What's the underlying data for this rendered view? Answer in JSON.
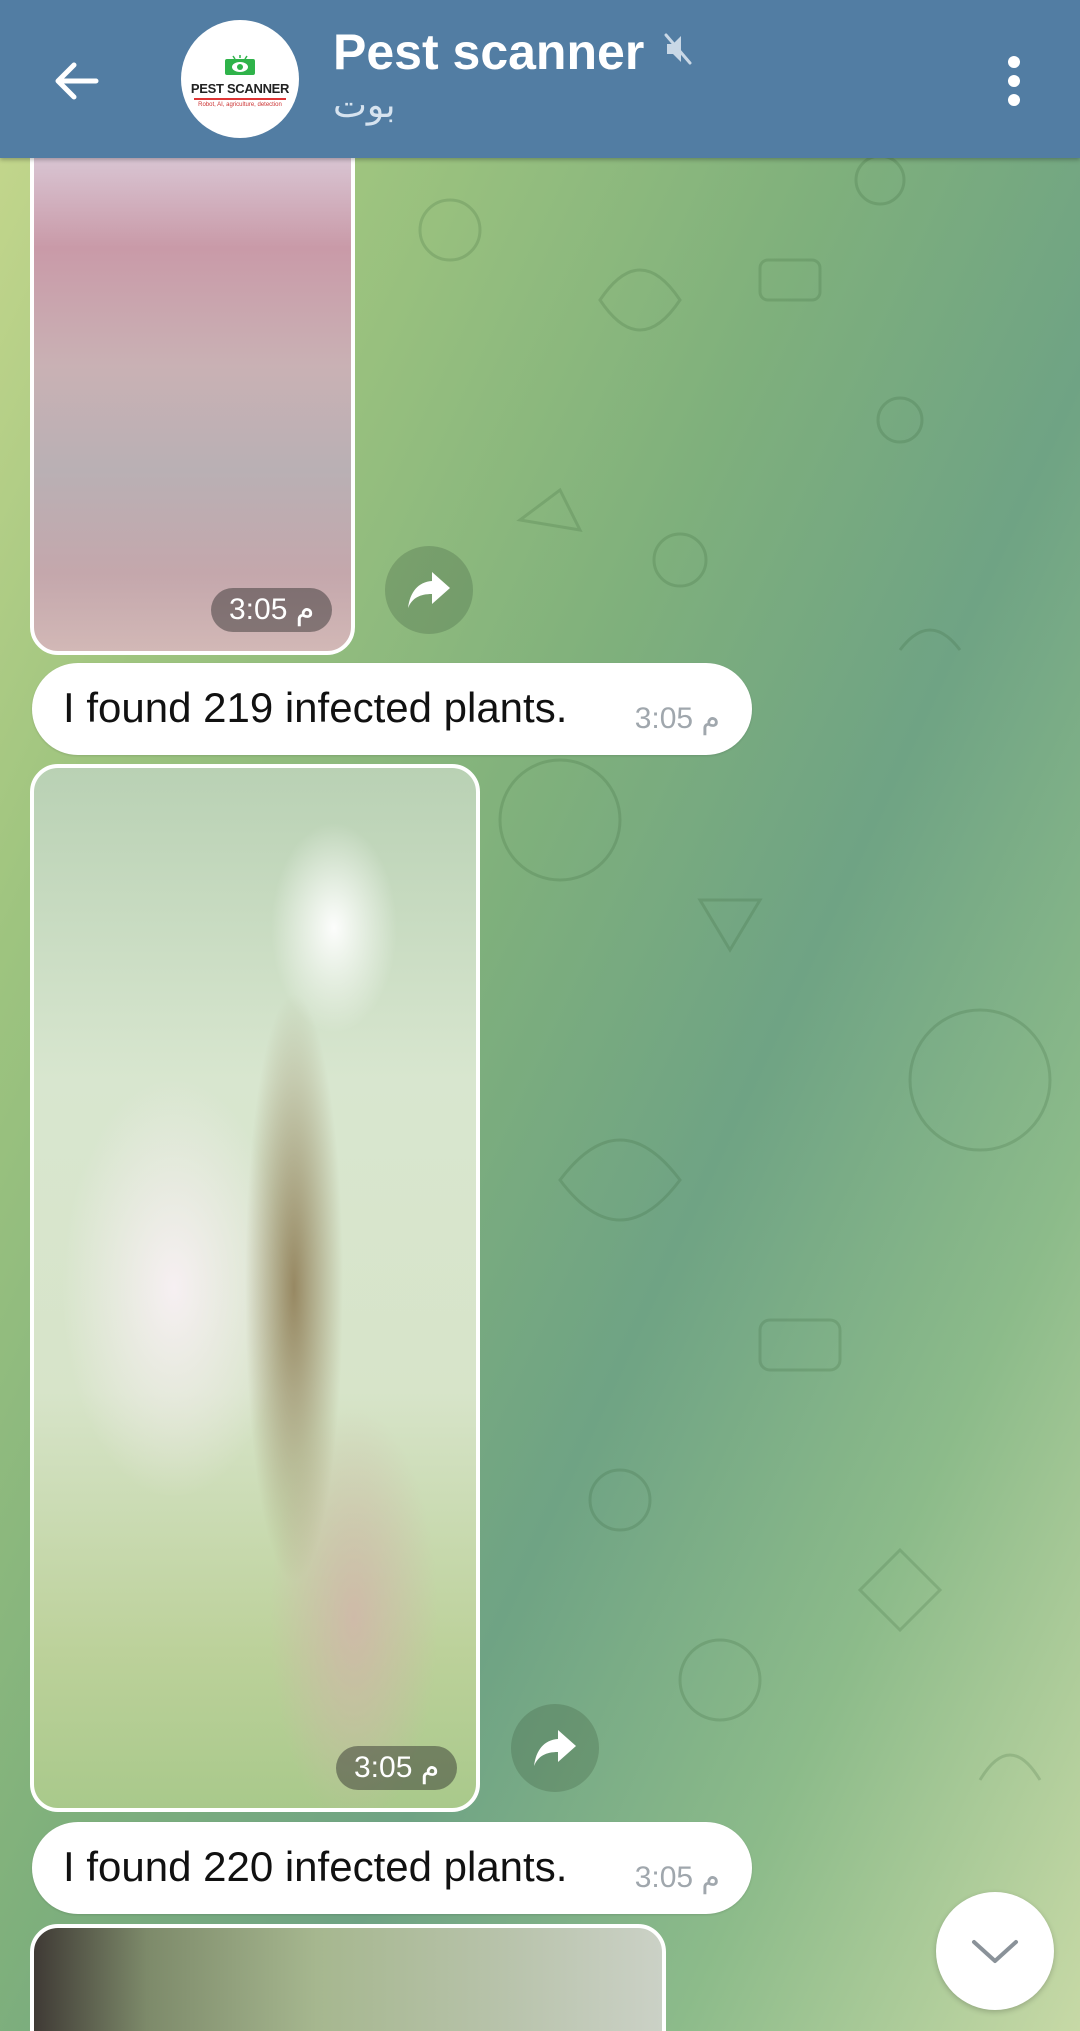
{
  "header": {
    "title": "Pest scanner",
    "subtitle": "بوت",
    "avatar": {
      "logo_title": "PEST SCANNER",
      "logo_sub": "Robot, AI, agriculture, detection"
    },
    "icons": {
      "back": "arrow-left-icon",
      "mute": "muted-speaker-icon",
      "menu": "more-vertical-icon"
    },
    "colors": {
      "bar": "#527da3",
      "title": "#ffffff",
      "subtitle": "#d6e3ef"
    }
  },
  "messages": [
    {
      "type": "media",
      "time": "3:05 م"
    },
    {
      "type": "text",
      "text": "I found 219 infected plants.",
      "time": "3:05 م"
    },
    {
      "type": "media",
      "time": "3:05 م"
    },
    {
      "type": "text",
      "text": "I found 220 infected plants.",
      "time": "3:05 م"
    },
    {
      "type": "media",
      "time": ""
    }
  ],
  "controls": {
    "forward_icon": "share-forward-icon",
    "scroll_down_icon": "chevron-down-icon"
  }
}
